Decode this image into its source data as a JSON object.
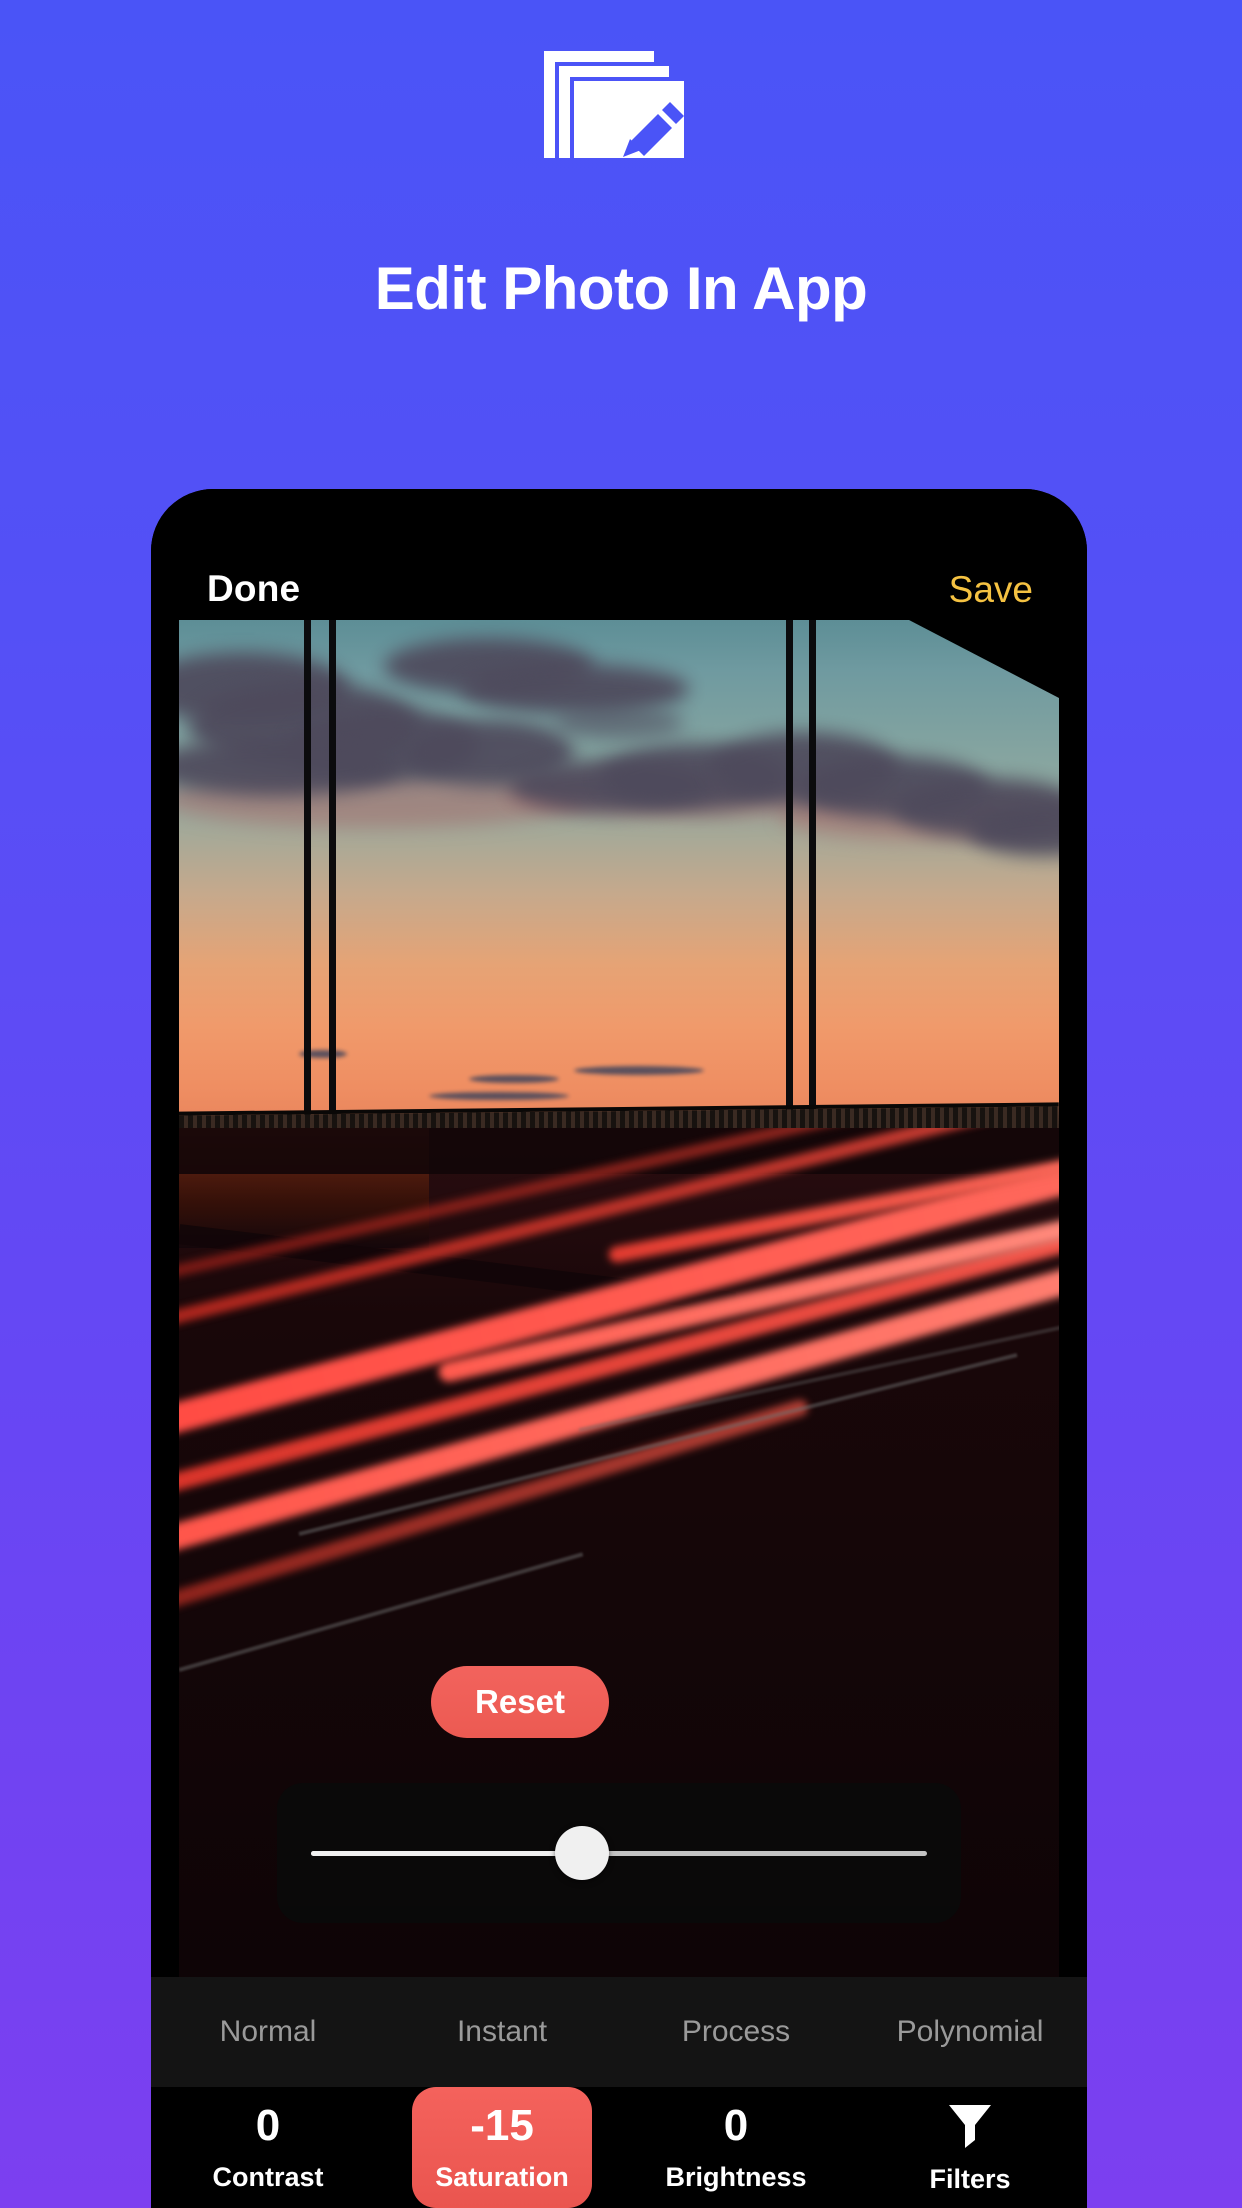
{
  "promo": {
    "icon_name": "edit-photo-stack-pencil-icon",
    "title": "Edit Photo In App",
    "title_color": "#ffffff",
    "background_top_color": "#4a54f7",
    "background_bottom_color": "#7c3ff0"
  },
  "phone": {
    "navbar": {
      "done_label": "Done",
      "save_label": "Save",
      "done_color": "#ffffff",
      "save_color": "#f5c242"
    },
    "photo": {
      "description": "Sunset highway long-exposure with red light trails and bridge pillars"
    },
    "reset_button": {
      "label": "Reset",
      "color": "#ec5a52"
    },
    "slider": {
      "value_percent": 44,
      "min": -100,
      "max": 100
    },
    "filters": [
      {
        "label": "Normal"
      },
      {
        "label": "Instant"
      },
      {
        "label": "Process"
      },
      {
        "label": "Polynomial"
      }
    ],
    "adjustments": [
      {
        "label": "Contrast",
        "value": "0",
        "icon": "",
        "active": false
      },
      {
        "label": "Saturation",
        "value": "-15",
        "icon": "",
        "active": true
      },
      {
        "label": "Brightness",
        "value": "0",
        "icon": "",
        "active": false
      },
      {
        "label": "Filters",
        "value": "",
        "icon": "funnel-icon",
        "active": false
      }
    ],
    "accent_color": "#ea554f"
  }
}
